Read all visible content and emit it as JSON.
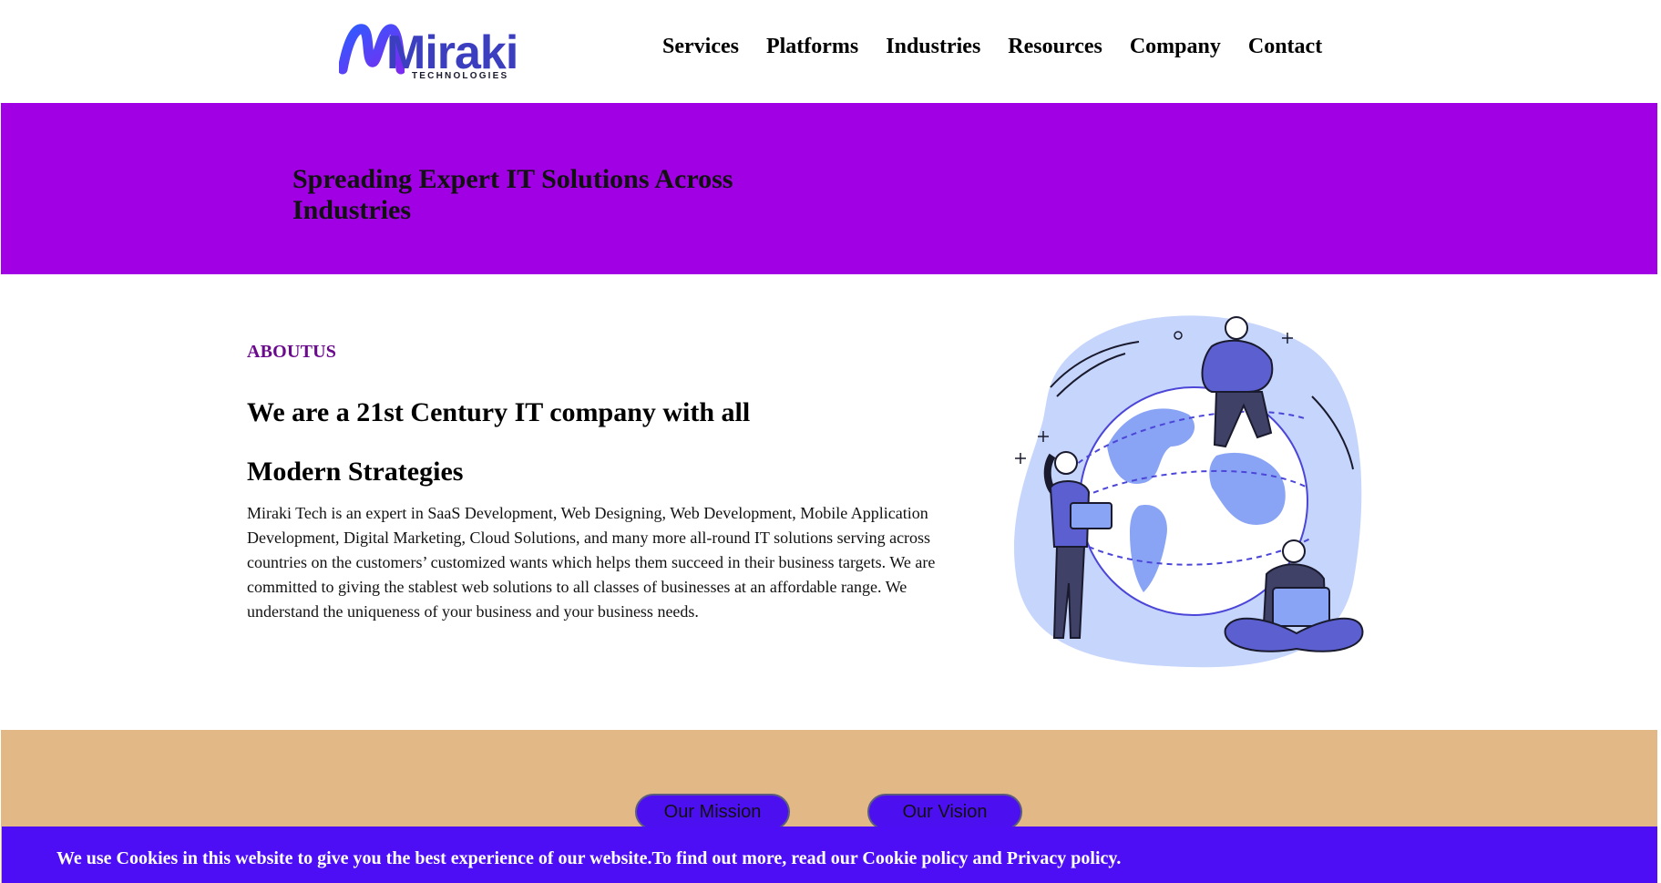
{
  "brand": {
    "name": "Miraki",
    "tagline": "TECHNOLOGIES",
    "primary_color": "#3b3fbf",
    "accent_color": "#a000e3"
  },
  "nav": {
    "items": [
      {
        "label": "Services"
      },
      {
        "label": "Platforms"
      },
      {
        "label": "Industries"
      },
      {
        "label": "Resources"
      },
      {
        "label": "Company"
      },
      {
        "label": "Contact"
      }
    ]
  },
  "hero": {
    "title": "Spreading Expert IT Solutions Across Industries",
    "background_color": "#a000e3"
  },
  "about": {
    "label": "ABOUTUS",
    "title_line1": "We are a 21st Century IT company with all",
    "title_line2": "Modern Strategies",
    "body": "Miraki Tech is an expert in SaaS Development, Web Designing, Web Development, Mobile Application Development, Digital Marketing, Cloud Solutions, and many more all-round IT solutions serving across countries on the customers’ customized wants which helps them succeed in their business targets. We are committed to giving the stablest web solutions to all classes of businesses at an affordable range. We understand the uniqueness of your business and your business needs.",
    "illustration_icon": "globe-people-illustration"
  },
  "mission_vision": {
    "background_color": "#e2b886",
    "mission_label": "Our Mission",
    "vision_label": "Our Vision"
  },
  "cookie_banner": {
    "text": "We use Cookies in this website to give you the best experience of our website.To find out more, read our Cookie policy and Privacy policy.",
    "background_color": "#4d0ef5"
  }
}
